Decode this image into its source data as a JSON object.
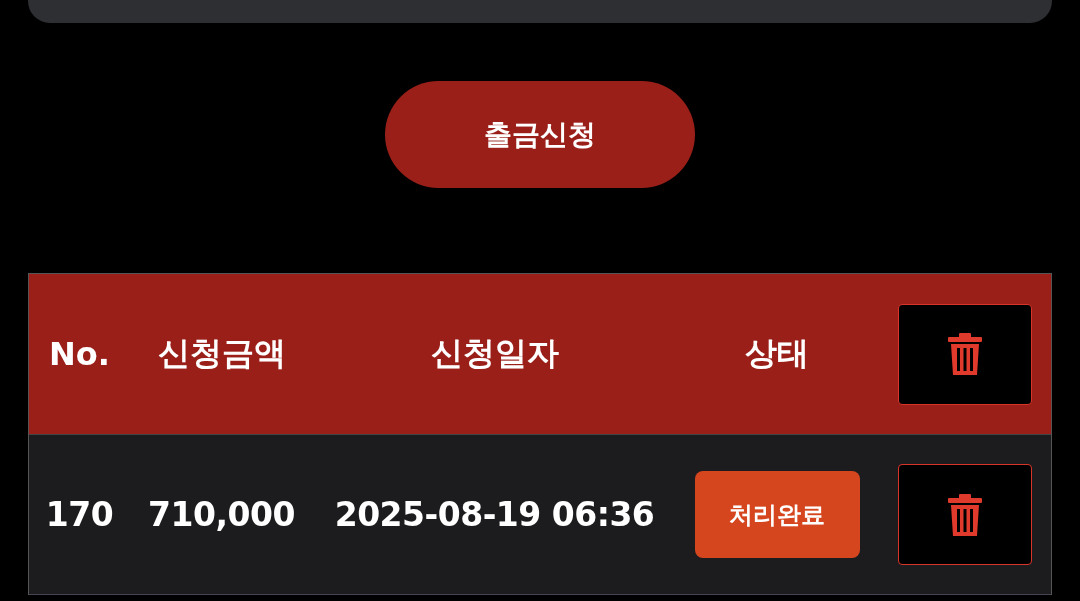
{
  "withdraw_button": {
    "label": "출금신청"
  },
  "table": {
    "columns": [
      "No.",
      "신청금액",
      "신청일자",
      "상태"
    ],
    "rows": [
      {
        "no": "170",
        "amount": "710,000",
        "date": "2025-08-19 06:36",
        "status": "처리완료"
      }
    ]
  }
}
